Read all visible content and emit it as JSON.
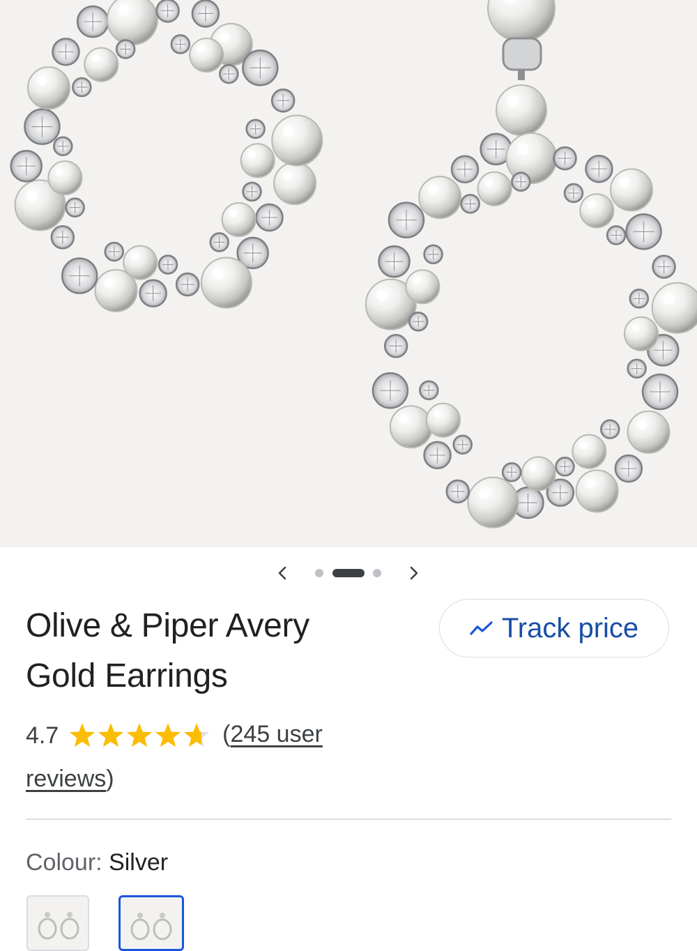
{
  "product": {
    "title_line1": "Olive & Piper Avery",
    "title_line2": "Gold Earrings",
    "rating_value": "4.7",
    "rating_stars": 4.7,
    "reviews_open": "(",
    "reviews_link": "245 user",
    "reviews_link_2": "reviews",
    "reviews_close": ")"
  },
  "actions": {
    "track_price_label": "Track price",
    "track_price_icon": "trending-line-icon"
  },
  "carousel": {
    "prev_icon": "chevron-left-icon",
    "next_icon": "chevron-right-icon",
    "dot_count": 3,
    "active_index": 1
  },
  "colour": {
    "label": "Colour:",
    "value": "Silver",
    "swatches": [
      "silver-pearl",
      "silver-pearl-selected"
    ]
  },
  "colors": {
    "accent": "#1a56db",
    "star": "#fbbc04",
    "text": "#202124",
    "muted": "#5f6368",
    "border": "#dadce0"
  }
}
